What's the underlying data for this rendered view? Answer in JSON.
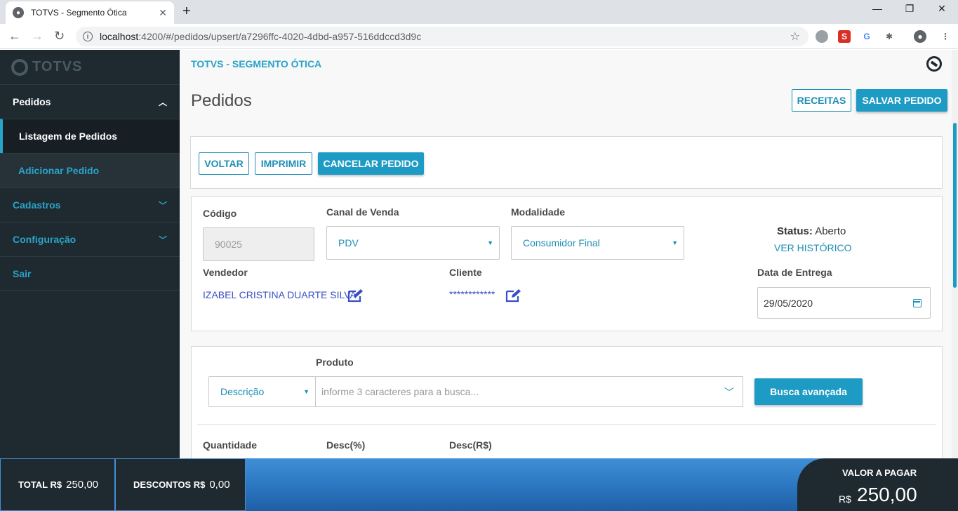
{
  "browser": {
    "tab_title": "TOTVS - Segmento Ótica",
    "url_host": "localhost",
    "url_path": ":4200/#/pedidos/upsert/a7296ffc-4020-4dbd-a957-516ddccd3d9c"
  },
  "sidebar": {
    "logo": "TOTVS",
    "items": [
      {
        "label": "Pedidos",
        "open": true
      },
      {
        "label": "Listagem de Pedidos"
      },
      {
        "label": "Adicionar Pedido"
      },
      {
        "label": "Cadastros"
      },
      {
        "label": "Configuração"
      },
      {
        "label": "Sair"
      }
    ]
  },
  "header": {
    "brand": "TOTVS - SEGMENTO ÓTICA",
    "title": "Pedidos",
    "receitas_label": "RECEITAS",
    "salvar_label": "SALVAR PEDIDO"
  },
  "actions": {
    "voltar": "VOLTAR",
    "imprimir": "IMPRIMIR",
    "cancelar": "CANCELAR PEDIDO"
  },
  "form": {
    "codigo_label": "Código",
    "codigo_value": "90025",
    "canal_label": "Canal de Venda",
    "canal_value": "PDV",
    "modalidade_label": "Modalidade",
    "modalidade_value": "Consumidor Final",
    "status_label": "Status:",
    "status_value": "Aberto",
    "historico_link": "VER HISTÓRICO",
    "vendedor_label": "Vendedor",
    "vendedor_value": "IZABEL CRISTINA DUARTE SILVA",
    "cliente_label": "Cliente",
    "cliente_value": "************",
    "entrega_label": "Data de Entrega",
    "entrega_value": "29/05/2020"
  },
  "produto": {
    "label": "Produto",
    "tipo_value": "Descrição",
    "search_placeholder": "informe 3 caracteres para a busca...",
    "busca_label": "Busca avançada",
    "quantidade_label": "Quantidade",
    "desc_pct_label": "Desc(%)",
    "desc_rs_label": "Desc(R$)"
  },
  "footer": {
    "total_label": "TOTAL R$",
    "total_value": "250,00",
    "descontos_label": "DESCONTOS R$",
    "descontos_value": "0,00",
    "pagar_label": "VALOR A PAGAR",
    "pagar_currency": "R$",
    "pagar_value": "250,00"
  },
  "colors": {
    "accent": "#1e9bc4",
    "sidebar": "#1f2a30"
  }
}
